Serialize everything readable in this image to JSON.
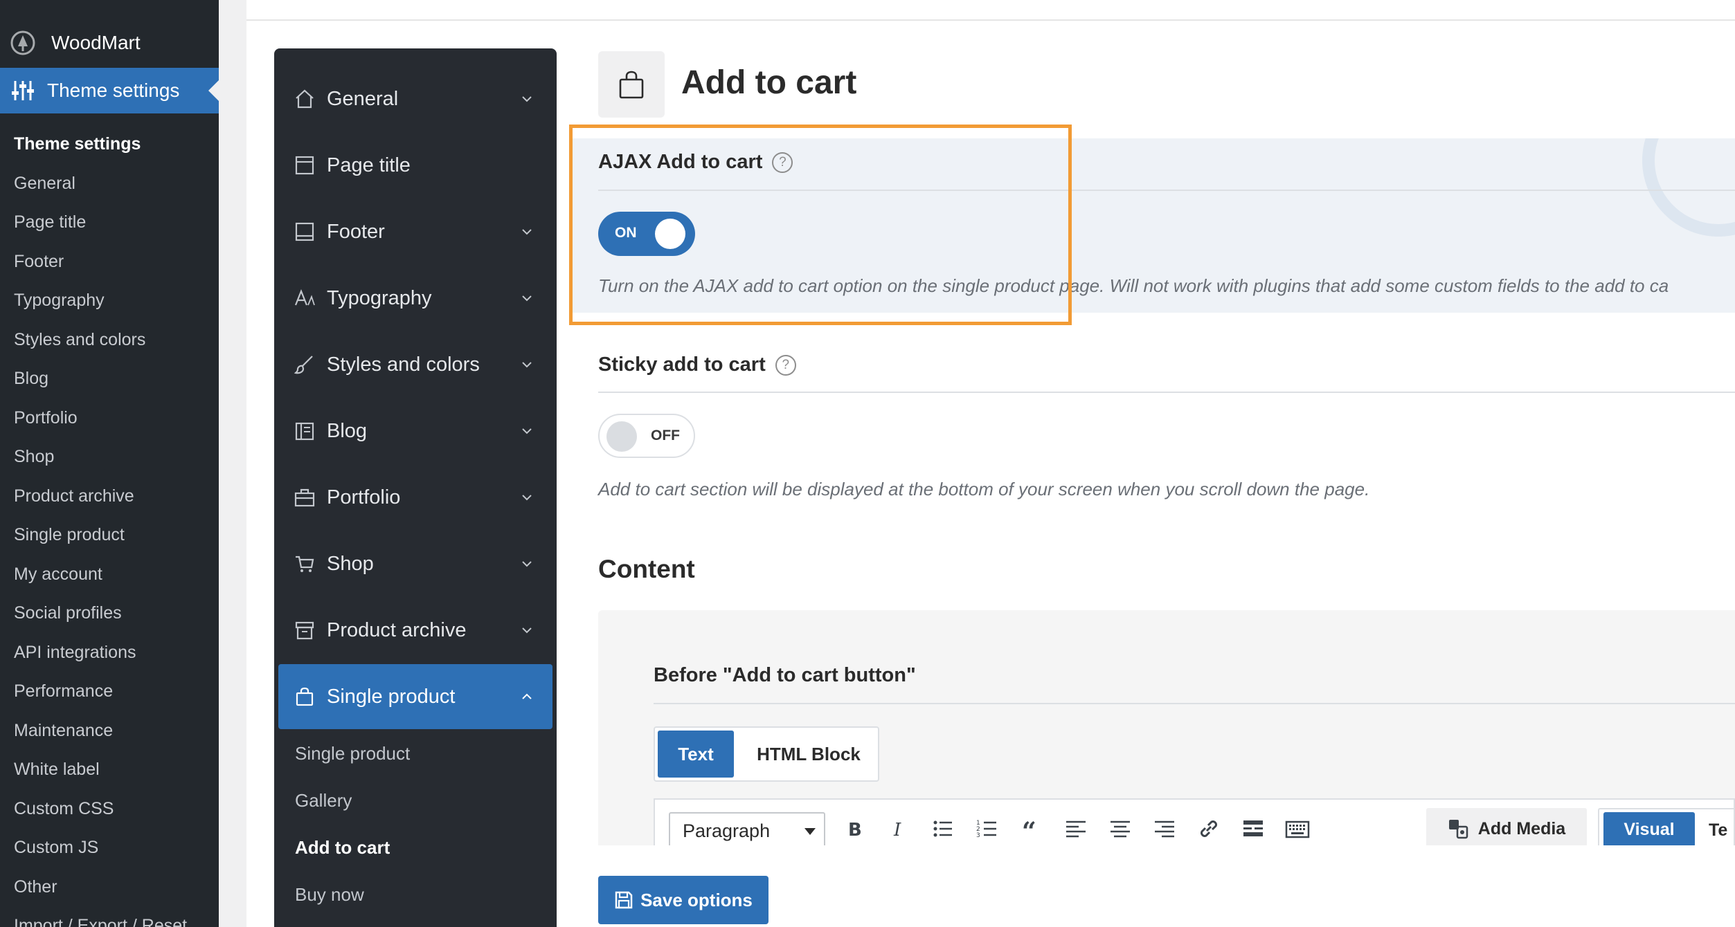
{
  "wp_sidebar": {
    "brand": "WoodMart",
    "active_menu": "Theme settings",
    "submenu": [
      "Theme settings",
      "General",
      "Page title",
      "Footer",
      "Typography",
      "Styles and colors",
      "Blog",
      "Portfolio",
      "Shop",
      "Product archive",
      "Single product",
      "My account",
      "Social profiles",
      "API integrations",
      "Performance",
      "Maintenance",
      "White label",
      "Custom CSS",
      "Custom JS",
      "Other",
      "Import / Export / Reset"
    ]
  },
  "theme_nav": {
    "items": [
      {
        "label": "General",
        "icon": "home-icon",
        "expandable": true
      },
      {
        "label": "Page title",
        "icon": "page-title-icon",
        "expandable": false
      },
      {
        "label": "Footer",
        "icon": "footer-icon",
        "expandable": true
      },
      {
        "label": "Typography",
        "icon": "typography-icon",
        "expandable": true
      },
      {
        "label": "Styles and colors",
        "icon": "brush-icon",
        "expandable": true
      },
      {
        "label": "Blog",
        "icon": "blog-icon",
        "expandable": true
      },
      {
        "label": "Portfolio",
        "icon": "briefcase-icon",
        "expandable": true
      },
      {
        "label": "Shop",
        "icon": "cart-icon",
        "expandable": true
      },
      {
        "label": "Product archive",
        "icon": "archive-icon",
        "expandable": true
      },
      {
        "label": "Single product",
        "icon": "bag-icon",
        "expandable": true,
        "active": true
      }
    ],
    "subitems": [
      "Single product",
      "Gallery",
      "Add to cart",
      "Buy now"
    ],
    "current_subitem": "Add to cart"
  },
  "page": {
    "title": "Add to cart",
    "icon": "bag-icon"
  },
  "options": {
    "ajax": {
      "title": "AJAX Add to cart",
      "help": "?",
      "toggle_label": "ON",
      "enabled": true,
      "description": "Turn on the AJAX add to cart option on the single product page. Will not work with plugins that add some custom fields to the add to ca"
    },
    "sticky": {
      "title": "Sticky add to cart",
      "help": "?",
      "toggle_label": "OFF",
      "enabled": false,
      "description": "Add to cart section will be displayed at the bottom of your screen when you scroll down the page."
    }
  },
  "content": {
    "section_title": "Content",
    "field_title": "Before \"Add to cart button\"",
    "tabs": [
      "Text",
      "HTML Block"
    ],
    "active_tab": "Text",
    "format_select": "Paragraph",
    "add_media": "Add Media",
    "editor_tabs": [
      "Visual",
      "Te"
    ]
  },
  "actions": {
    "save": "Save options"
  },
  "colors": {
    "accent": "#2e70b5",
    "highlight": "#f29b35",
    "sidebar_bg": "#23282d",
    "nav_bg": "#272b31"
  }
}
